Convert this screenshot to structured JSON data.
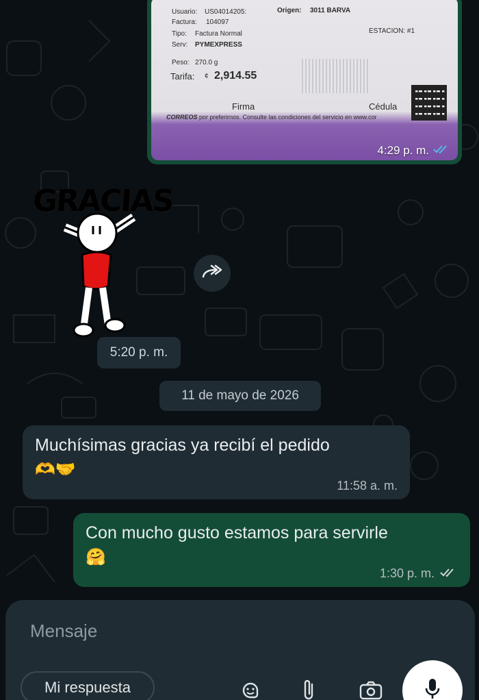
{
  "receipt": {
    "usuario_label": "Usuario:",
    "usuario_value": "US04014205:",
    "origen_label": "Origen:",
    "origen_value": "3011 BARVA",
    "factura_label": "Factura:",
    "factura_value": "104097",
    "tipo_label": "Tipo:",
    "tipo_value": "Factura Normal",
    "estacion": "ESTACION: #1",
    "serv_label": "Serv:",
    "serv_value": "PYMEXPRESS",
    "peso_label": "Peso:",
    "peso_value": "270.0 g",
    "tarifa_label": "Tarifa:",
    "tarifa_currency": "¢",
    "tarifa_value": "2,914.55",
    "firma": "Firma",
    "cedula": "Cédula",
    "brand": "CORREOS",
    "footer": "por preferirnos. Consulte las condiciones del servicio en www.cor"
  },
  "messages": [
    {
      "direction": "out",
      "type": "image",
      "time": "4:29 p. m.",
      "status": "read"
    },
    {
      "direction": "in",
      "type": "sticker",
      "sticker_text": "GRACIAS",
      "time": "5:20 p. m."
    },
    {
      "direction": "in",
      "type": "text",
      "text": "Muchísimas gracias ya recibí el pedido",
      "emoji": "🫶🤝",
      "time": "11:58 a. m."
    },
    {
      "direction": "out",
      "type": "text",
      "text": "Con mucho gusto estamos para servirle",
      "emoji": "🤗",
      "time": "1:30 p. m.",
      "status": "delivered"
    }
  ],
  "date_separator": "11 de mayo de 2026",
  "composer": {
    "placeholder": "Mensaje",
    "reply_chip": "Mi respuesta",
    "icons": [
      "sticker-icon",
      "attach-icon",
      "camera-icon",
      "mic-icon"
    ]
  },
  "colors": {
    "background": "#0b1014",
    "incoming_bubble": "#202c33",
    "outgoing_bubble": "#144d37",
    "read_ticks": "#53bdeb",
    "delivered_ticks": "#d1d7db"
  }
}
